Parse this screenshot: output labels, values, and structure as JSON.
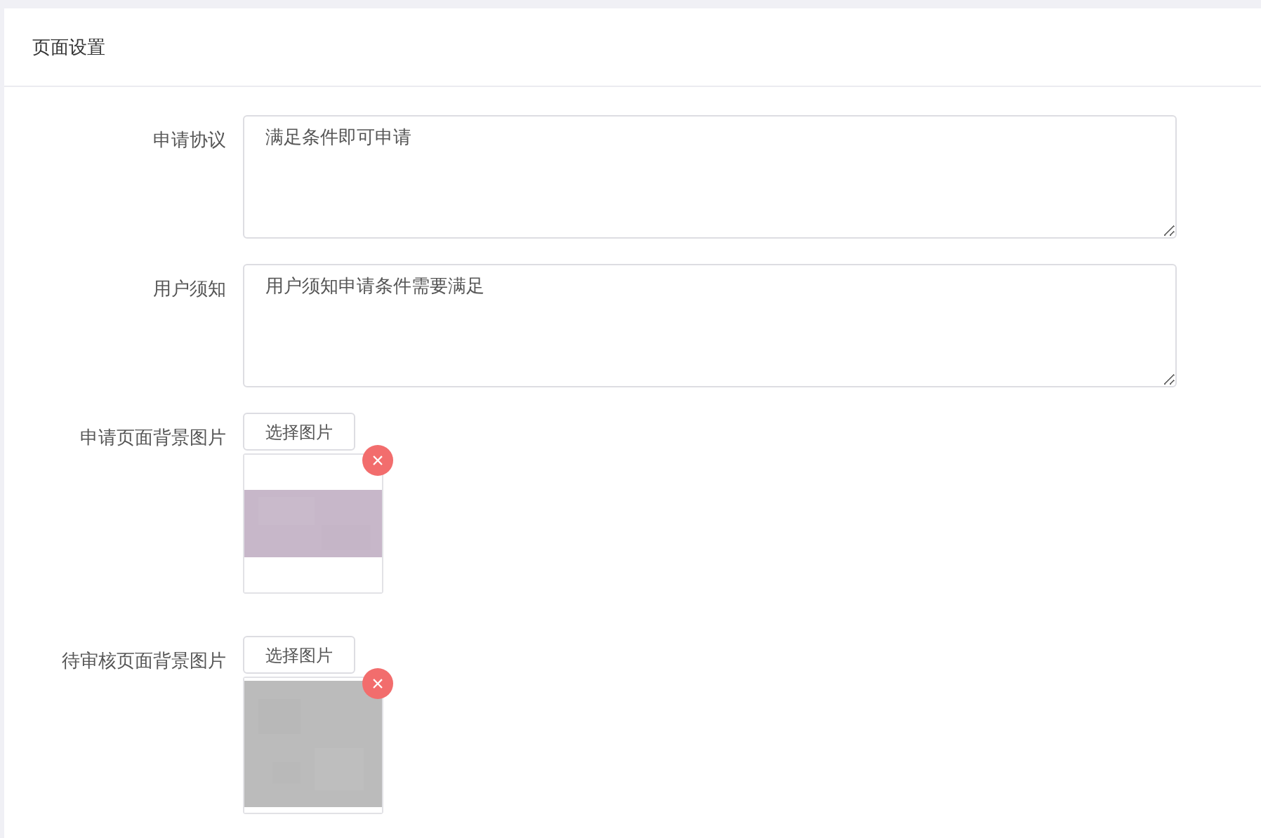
{
  "panel": {
    "title": "页面设置"
  },
  "fields": [
    {
      "kind": "textarea",
      "label": "申请协议",
      "value": "满足条件即可申请"
    },
    {
      "kind": "textarea",
      "label": "用户须知",
      "value": "用户须知申请条件需要满足"
    },
    {
      "label": "申请页面背景图片",
      "button": "选择图片",
      "remove": "×"
    },
    {
      "label": "待审核页面背景图片",
      "button": "选择图片",
      "remove": "×"
    }
  ]
}
